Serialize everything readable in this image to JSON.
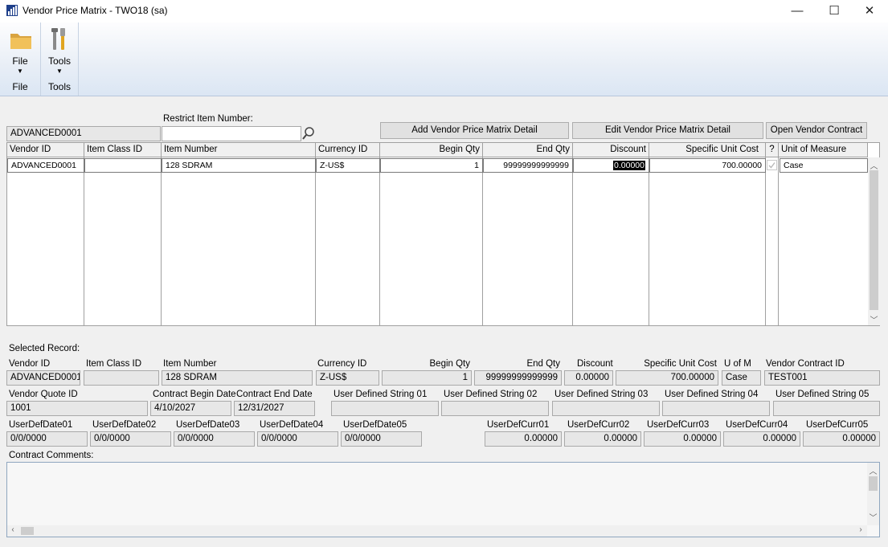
{
  "window": {
    "title": "Vendor Price Matrix  -  TWO18 (sa)",
    "minimize": "—",
    "maximize": "☐",
    "close": "✕"
  },
  "ribbon": {
    "file": {
      "label": "File",
      "group": "File",
      "icon": "folder-icon"
    },
    "tools": {
      "label": "Tools",
      "group": "Tools",
      "icon": "tools-icon"
    }
  },
  "restrict": {
    "label": "Restrict Item Number:",
    "vendor_value": "ADVANCED0001",
    "item_value": ""
  },
  "buttons": {
    "add_detail": "Add Vendor Price Matrix Detail",
    "edit_detail": "Edit Vendor Price Matrix Detail",
    "open_contract": "Open Vendor Contract"
  },
  "grid": {
    "headers": {
      "vendor_id": "Vendor ID",
      "item_class_id": "Item Class ID",
      "item_number": "Item Number",
      "currency_id": "Currency ID",
      "begin_qty": "Begin Qty",
      "end_qty": "End Qty",
      "discount": "Discount",
      "specific_unit_cost": "Specific Unit Cost",
      "q": "?",
      "unit_of_measure": "Unit of Measure"
    },
    "rows": [
      {
        "vendor_id": "ADVANCED0001",
        "item_class_id": "",
        "item_number": "128 SDRAM",
        "currency_id": "Z-US$",
        "begin_qty": "1",
        "end_qty": "99999999999999",
        "discount": "0.00000",
        "specific_unit_cost": "700.00000",
        "checked": true,
        "unit_of_measure": "Case"
      }
    ]
  },
  "selected": {
    "heading": "Selected Record:",
    "labels": {
      "vendor_id": "Vendor ID",
      "item_class_id": "Item Class ID",
      "item_number": "Item Number",
      "currency_id": "Currency ID",
      "begin_qty": "Begin Qty",
      "end_qty": "End Qty",
      "discount": "Discount",
      "specific_unit_cost": "Specific Unit Cost",
      "u_of_m": "U of M",
      "vendor_contract_id": "Vendor Contract ID",
      "vendor_quote_id": "Vendor Quote ID",
      "contract_begin_date": "Contract Begin Date",
      "contract_end_date": "Contract End Date",
      "uds01": "User Defined String 01",
      "uds02": "User Defined String 02",
      "uds03": "User Defined String 03",
      "uds04": "User Defined String 04",
      "uds05": "User Defined String 05",
      "udd01": "UserDefDate01",
      "udd02": "UserDefDate02",
      "udd03": "UserDefDate03",
      "udd04": "UserDefDate04",
      "udd05": "UserDefDate05",
      "udc01": "UserDefCurr01",
      "udc02": "UserDefCurr02",
      "udc03": "UserDefCurr03",
      "udc04": "UserDefCurr04",
      "udc05": "UserDefCurr05",
      "comments": "Contract Comments:"
    },
    "values": {
      "vendor_id": "ADVANCED0001",
      "item_class_id": "",
      "item_number": "128 SDRAM",
      "currency_id": "Z-US$",
      "begin_qty": "1",
      "end_qty": "99999999999999",
      "discount": "0.00000",
      "specific_unit_cost": "700.00000",
      "u_of_m": "Case",
      "vendor_contract_id": "TEST001",
      "vendor_quote_id": "1001",
      "contract_begin_date": "4/10/2027",
      "contract_end_date": "12/31/2027",
      "uds01": "",
      "uds02": "",
      "uds03": "",
      "uds04": "",
      "uds05": "",
      "udd01": "0/0/0000",
      "udd02": "0/0/0000",
      "udd03": "0/0/0000",
      "udd04": "0/0/0000",
      "udd05": "0/0/0000",
      "udc01": "0.00000",
      "udc02": "0.00000",
      "udc03": "0.00000",
      "udc04": "0.00000",
      "udc05": "0.00000",
      "comments": ""
    }
  }
}
